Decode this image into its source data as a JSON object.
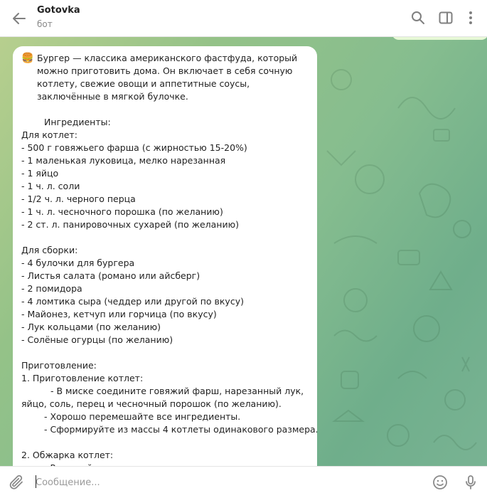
{
  "header": {
    "title": "Gotovka",
    "subtitle": "бот"
  },
  "message": {
    "emoji": "🍔",
    "intro": "Бургер — классика американского фастфуда, который можно приготовить дома. Он включает в себя сочную котлету, свежие овощи и аппетитные соусы, заключённые в мягкой булочке.",
    "lines": [
      {
        "text": "",
        "indent": 0
      },
      {
        "text": "Ингредиенты:",
        "indent": 1
      },
      {
        "text": "Для котлет:",
        "indent": 0
      },
      {
        "text": "- 500 г говяжьего фарша (с жирностью 15-20%)",
        "indent": 0
      },
      {
        "text": "- 1 маленькая луковица, мелко нарезанная",
        "indent": 0
      },
      {
        "text": "- 1 яйцо",
        "indent": 0
      },
      {
        "text": "- 1 ч. л. соли",
        "indent": 0
      },
      {
        "text": "- 1/2 ч. л. черного перца",
        "indent": 0
      },
      {
        "text": "- 1 ч. л. чесночного порошка (по желанию)",
        "indent": 0
      },
      {
        "text": "- 2 ст. л. панировочных сухарей (по желанию)",
        "indent": 0
      },
      {
        "text": "",
        "indent": 0
      },
      {
        "text": "Для сборки:",
        "indent": 0
      },
      {
        "text": "- 4 булочки для бургера",
        "indent": 0
      },
      {
        "text": "- Листья салата (романо или айсберг)",
        "indent": 0
      },
      {
        "text": "- 2 помидора",
        "indent": 0
      },
      {
        "text": "- 4 ломтика сыра (чеддер или другой по вкусу)",
        "indent": 0
      },
      {
        "text": "- Майонез, кетчуп или горчица (по вкусу)",
        "indent": 0
      },
      {
        "text": "- Лук кольцами (по желанию)",
        "indent": 0
      },
      {
        "text": "- Солёные огурцы (по желанию)",
        "indent": 0
      },
      {
        "text": "",
        "indent": 0
      },
      {
        "text": "Приготовление:",
        "indent": 0
      },
      {
        "text": "1. Приготовление котлет:",
        "indent": 0
      },
      {
        "text": "- В миске соедините говяжий фарш, нарезанный лук,",
        "indent": 2
      },
      {
        "text": "яйцо, соль, перец и чесночный порошок (по желанию).",
        "indent": -1
      },
      {
        "text": "- Хорошо перемешайте все ингредиенты.",
        "indent": 3
      },
      {
        "text": "- Сформируйте из массы 4 котлеты одинакового размера.",
        "indent": 3
      },
      {
        "text": "",
        "indent": 0
      },
      {
        "text": "2. Обжарка котлет:",
        "indent": 0
      },
      {
        "text": "- Разогрейте",
        "indent": 3
      }
    ]
  },
  "composer": {
    "placeholder": "Сообщение..."
  },
  "icons": {
    "back": "arrow-left-icon",
    "search": "search-icon",
    "sidebar": "sidebar-toggle-icon",
    "more": "more-vertical-icon",
    "attach": "paperclip-icon",
    "emoji": "smile-icon",
    "mic": "microphone-icon"
  },
  "colors": {
    "chat_bg": "#86bd8f",
    "bubble": "#ffffff",
    "outgoing_bubble": "#e7f8d6",
    "accent": "#3390ec"
  }
}
